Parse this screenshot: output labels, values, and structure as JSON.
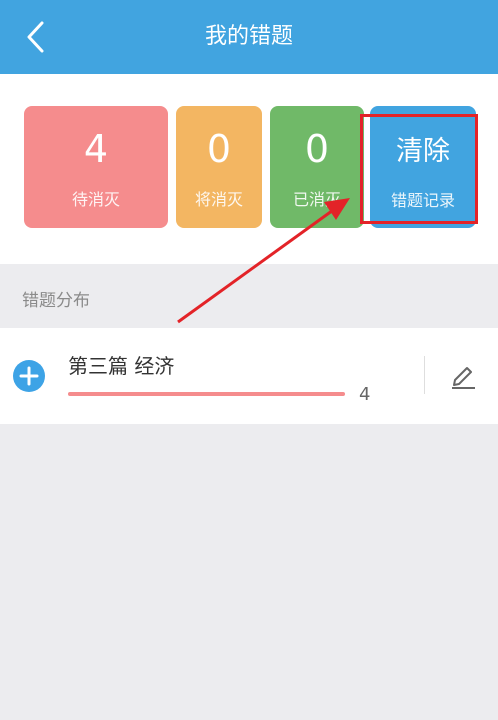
{
  "header": {
    "title": "我的错题"
  },
  "stats": [
    {
      "value": "4",
      "label": "待消灭",
      "color": "#f58c8d"
    },
    {
      "value": "0",
      "label": "将消灭",
      "color": "#f3b662"
    },
    {
      "value": "0",
      "label": "已消灭",
      "color": "#70b968"
    }
  ],
  "clear_button": {
    "title": "清除",
    "subtitle": "错题记录",
    "color": "#41a4e0"
  },
  "section": {
    "label": "错题分布"
  },
  "topics": [
    {
      "name": "第三篇 经济",
      "count": "4",
      "progress": 1.0
    }
  ],
  "annotation": {
    "highlight_color": "#e32328"
  }
}
